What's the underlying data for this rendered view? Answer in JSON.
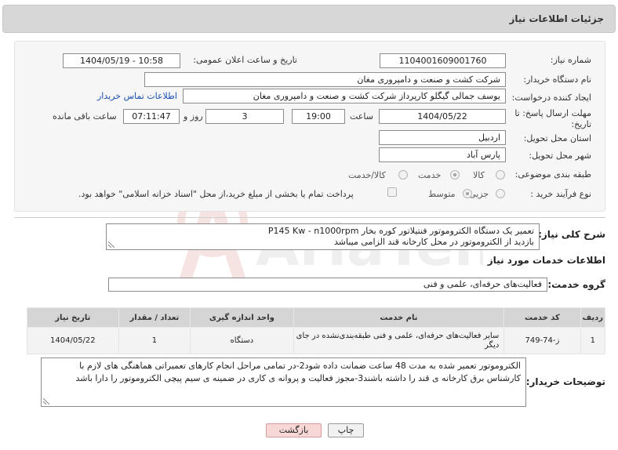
{
  "header": {
    "title": "جزئیات اطلاعات نیاز"
  },
  "form": {
    "need_number": {
      "label": "شماره نیاز:",
      "value": "1104001609001760"
    },
    "announce_datetime": {
      "label": "تاریخ و ساعت اعلان عمومی:",
      "value": "1404/05/19 - 10:58"
    },
    "buyer_org": {
      "label": "نام دستگاه خریدار:",
      "value": "شرکت کشت و صنعت و دامپروری مغان"
    },
    "requester": {
      "label": "ایجاد کننده درخواست:",
      "value": "یوسف جمالی گیگلو کارپرداز شرکت کشت و صنعت و دامپروری مغان",
      "contact_link": "اطلاعات تماس خریدار"
    },
    "deadline": {
      "label_line1": "مهلت ارسال پاسخ: تا",
      "label_line2": "تاریخ:",
      "date": "1404/05/22",
      "time_label": "ساعت",
      "time": "19:00",
      "days": "3",
      "days_label": "روز و",
      "remaining": "07:11:47",
      "remaining_label": "ساعت باقی مانده"
    },
    "province": {
      "label": "استان محل تحویل:",
      "value": "اردبیل"
    },
    "city": {
      "label": "شهر محل تحویل:",
      "value": "پارس آباد"
    },
    "category": {
      "label": "طبقه بندی موضوعی:",
      "options": [
        "کالا",
        "خدمت",
        "کالا/خدمت"
      ],
      "selected": "خدمت"
    },
    "purchase_type": {
      "label": "نوع فرآیند خرید :",
      "options": [
        "جزیی",
        "متوسط"
      ],
      "selected": "متوسط",
      "payment_note": "پرداخت تمام یا بخشی از مبلغ خرید،از محل \"اسناد خزانه اسلامی\" خواهد بود."
    }
  },
  "description": {
    "label": "شرح کلی نیاز:",
    "line1": "تعمیر یک دستگاه الکتروموتور فنتیلاتور کوره بخار P145 Kw - n1000rpm",
    "line2": "بازدید از الکتروموتور در محل کارخانه قند الزامی میباشد"
  },
  "services": {
    "section_title": "اطلاعات خدمات مورد نیاز",
    "group_label": "گروه خدمت:",
    "group_value": "فعالیت‌های حرفه‌ای، علمی و فنی",
    "columns": [
      "ردیف",
      "کد خدمت",
      "نام خدمت",
      "واحد اندازه گیری",
      "تعداد / مقدار",
      "تاریخ نیاز"
    ],
    "rows": [
      {
        "row": "1",
        "code": "ز-74-749",
        "name": "سایر فعالیت‌های حرفه‌ای، علمی و فنی طبقه‌بندی‌نشده در جای دیگر",
        "unit": "دستگاه",
        "qty": "1",
        "date": "1404/05/22"
      }
    ]
  },
  "buyer_notes": {
    "label": "توضیحات خریدار:",
    "text": "الکتروموتور تعمیر شده به مدت 48 ساعت ضمانت داده شود2-در تمامی مراحل انجام کارهای تعمیراتی هماهنگی های لازم با کارشناس برق کارخانه ی قند را داشته باشند3-مجوز فعالیت و پروانه ی کاری در ضمینه ی سیم پیچی الکتروموتور را دارا باشد"
  },
  "buttons": {
    "print": "چاپ",
    "back": "بازگشت"
  },
  "colors": {
    "header_bg": "#d7d7d7",
    "link": "#1a4fb5",
    "back_button_bg": "#f8d7d7",
    "watermark": "#c0392b"
  }
}
